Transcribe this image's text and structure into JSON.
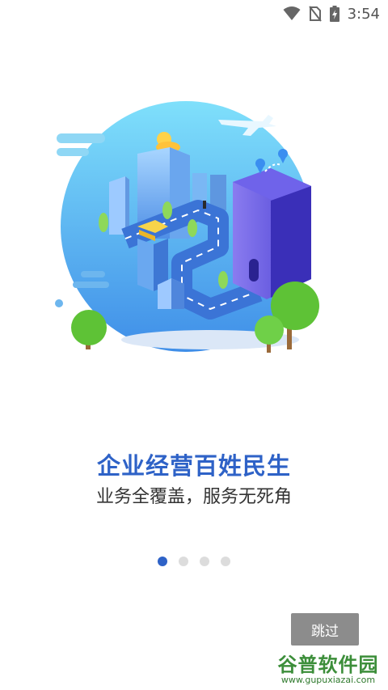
{
  "status_bar": {
    "time": "3:54",
    "icons": [
      "wifi-icon",
      "no-sim-icon",
      "battery-charging-icon"
    ]
  },
  "onboarding": {
    "illustration": "city-illustration",
    "headline": "企业经营百姓民生",
    "subline": "业务全覆盖，服务无死角",
    "page_indicator": {
      "total": 4,
      "active_index": 0
    }
  },
  "skip_button": {
    "label": "跳过"
  },
  "watermark": {
    "title": "谷普软件园",
    "url": "www.gupuxiazai.com"
  },
  "colors": {
    "accent": "#2e62c7",
    "skip_button_bg": "#8c8c8c",
    "watermark": "#3c8e3a"
  }
}
